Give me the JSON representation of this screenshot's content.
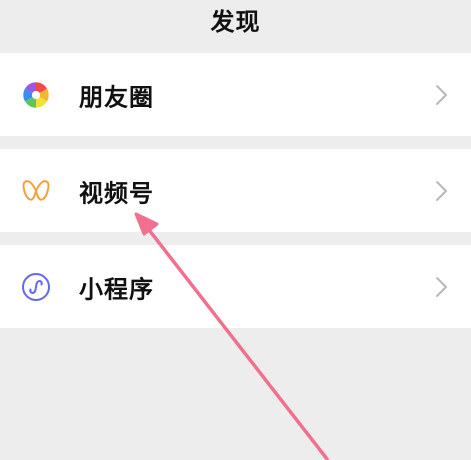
{
  "header": {
    "title": "发现"
  },
  "items": [
    {
      "label": "朋友圈",
      "icon": "moments-icon"
    },
    {
      "label": "视频号",
      "icon": "channels-icon"
    },
    {
      "label": "小程序",
      "icon": "mini-program-icon"
    }
  ],
  "colors": {
    "background": "#ededed",
    "row": "#ffffff",
    "text": "#111111",
    "chevron": "#b8b8b8",
    "channels_icon": "#f3a23b",
    "mini_program_icon": "#6467f0",
    "annotation_arrow": "#f0708f"
  }
}
